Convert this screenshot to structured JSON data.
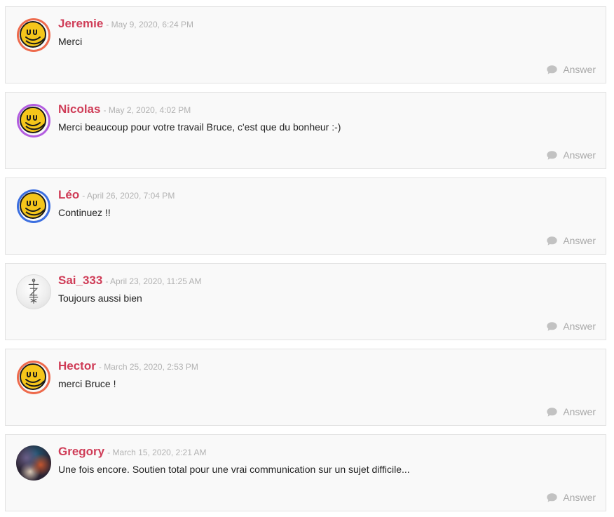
{
  "comments": [
    {
      "author": "Jeremie",
      "date": "- May 9, 2020, 6:24 PM",
      "text": "Merci",
      "answer_label": "Answer",
      "avatar": "smiley-coin-icon",
      "ring_color": "#ee6b4d"
    },
    {
      "author": "Nicolas",
      "date": "- May 2, 2020, 4:02 PM",
      "text": "Merci beaucoup pour votre travail Bruce, c'est que du bonheur :-)",
      "answer_label": "Answer",
      "avatar": "smiley-coin-icon",
      "ring_color": "#b35ee0"
    },
    {
      "author": "Léo",
      "date": "- April 26, 2020, 7:04 PM",
      "text": "Continuez !!",
      "answer_label": "Answer",
      "avatar": "smiley-coin-icon",
      "ring_color": "#3c6fe0"
    },
    {
      "author": "Sai_333",
      "date": "- April 23, 2020, 11:25 AM",
      "text": "Toujours aussi bien",
      "answer_label": "Answer",
      "avatar": "sword-sketch-icon"
    },
    {
      "author": "Hector",
      "date": "- March 25, 2020, 2:53 PM",
      "text": "merci Bruce !",
      "answer_label": "Answer",
      "avatar": "smiley-coin-icon",
      "ring_color": "#ee6b4d"
    },
    {
      "author": "Gregory",
      "date": "- March 15, 2020, 2:21 AM",
      "text": "Une fois encore. Soutien total pour une vrai communication sur un sujet difficile...",
      "answer_label": "Answer",
      "avatar": "photo-avatar"
    }
  ],
  "colors": {
    "author": "#cf3c57",
    "date": "#b2b2b2",
    "answer": "#a8a8a8",
    "card_bg": "#f9f9f9",
    "card_border": "#e2e2e2"
  }
}
